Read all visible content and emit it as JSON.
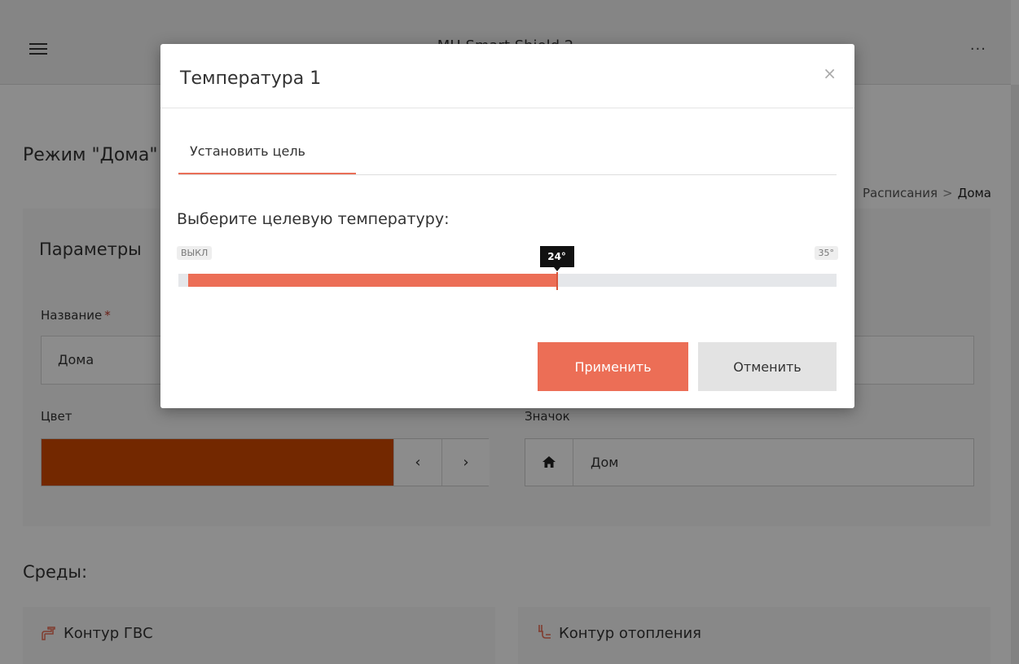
{
  "header": {
    "title": "MH Smart Shield 2",
    "menu_icon": "hamburger-icon",
    "more_label": "···"
  },
  "page": {
    "title": "Режим \"Дома\"",
    "breadcrumb": {
      "previous": "Расписания",
      "separator": ">",
      "current": "Дома"
    }
  },
  "params": {
    "title": "Параметры",
    "name_label": "Название",
    "required_mark": "*",
    "name_value": "Дома",
    "color_label": "Цвет",
    "color_value": "#d14a00",
    "prev_label": "‹",
    "next_label": "›",
    "icon_label": "Значок",
    "icon_value": "Дом",
    "icon_name": "home-icon"
  },
  "environments": {
    "title": "Среды:",
    "items": [
      {
        "label": "Контур ГВС",
        "icon": "faucet-icon"
      },
      {
        "label": "Контур отопления",
        "icon": "radiator-valve-icon"
      }
    ]
  },
  "modal": {
    "title": "Температура 1",
    "close_label": "×",
    "tab_label": "Установить цель",
    "prompt": "Выберите целевую температуру:",
    "slider": {
      "min_label": "ВЫКЛ",
      "max_label": "35°",
      "value_label": "24°",
      "position_fraction": 0.575
    },
    "apply_label": "Применить",
    "cancel_label": "Отменить"
  },
  "colors": {
    "accent": "#ec6e56",
    "selected_color": "#d14a00"
  }
}
